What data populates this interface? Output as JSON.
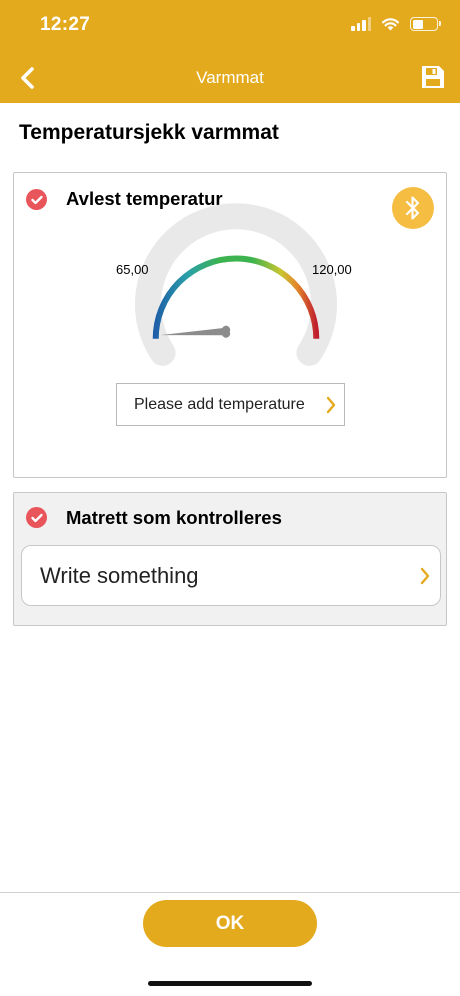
{
  "status_bar": {
    "time": "12:27",
    "battery_level": 0.45
  },
  "nav": {
    "title": "Varmmat",
    "back_icon": "chevron-left-icon",
    "save_icon": "floppy-disk-icon"
  },
  "page": {
    "title": "Temperatursjekk varmmat"
  },
  "temperature_card": {
    "title": "Avlest temperatur",
    "status_icon": "check-circle-icon",
    "bluetooth_icon": "bluetooth-icon",
    "gauge": {
      "min_label": "65,00",
      "max_label": "120,00",
      "min": 65,
      "max": 120,
      "value": null
    },
    "input_placeholder": "Please add temperature"
  },
  "dish_card": {
    "title": "Matrett som kontrolleres",
    "status_icon": "check-circle-icon",
    "input_placeholder": "Write something"
  },
  "footer": {
    "ok_label": "OK"
  },
  "colors": {
    "accent": "#e4aa1e",
    "check": "#e8555a",
    "bluetooth": "#f5bd42"
  }
}
